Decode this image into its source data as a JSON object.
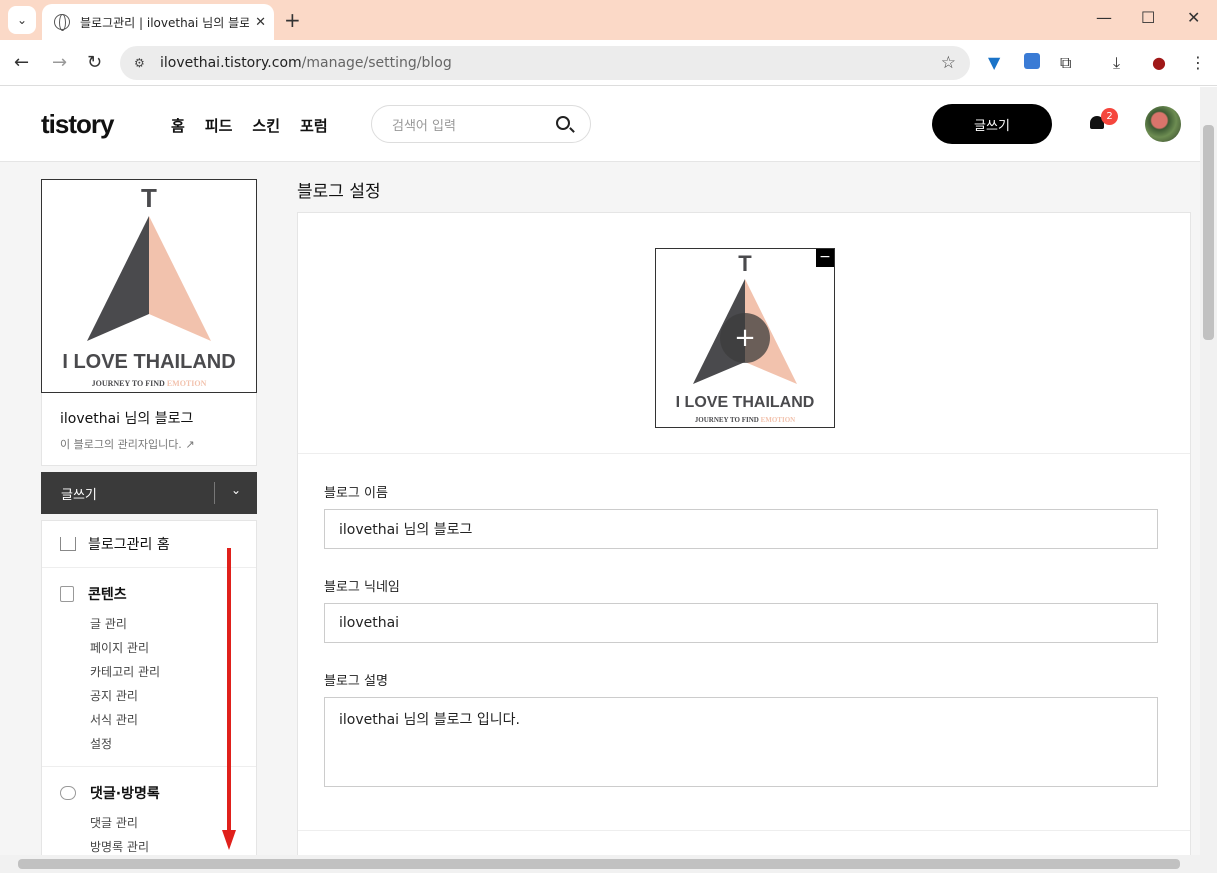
{
  "browser": {
    "tab_title": "블로그관리 | ilovethai 님의 블로그",
    "url_host": "ilovethai.tistory.com",
    "url_path": "/manage/setting/blog",
    "notification_count": "2"
  },
  "header": {
    "logo": "tistory",
    "nav": [
      "홈",
      "피드",
      "스킨",
      "포럼"
    ],
    "search_placeholder": "검색어 입력",
    "write_label": "글쓰기"
  },
  "sidebar": {
    "logo_text": "I LOVE THAILAND",
    "logo_sub1": "JOURNEY TO FIND",
    "logo_sub2": "EMOTION",
    "logo_letter": "T",
    "blog_name": "ilovethai 님의 블로그",
    "admin_note": "이 블로그의 관리자입니다.",
    "write_label": "글쓰기",
    "home_label": "블로그관리 홈",
    "groups": [
      {
        "title": "콘텐츠",
        "items": [
          "글 관리",
          "페이지 관리",
          "카테고리 관리",
          "공지 관리",
          "서식 관리",
          "설정"
        ]
      },
      {
        "title": "댓글·방명록",
        "items": [
          "댓글 관리",
          "방명록 관리"
        ]
      }
    ]
  },
  "content": {
    "title": "블로그 설정",
    "fields": [
      {
        "label": "블로그 이름",
        "value": "ilovethai 님의 블로그"
      },
      {
        "label": "블로그 닉네임",
        "value": "ilovethai"
      },
      {
        "label": "블로그 설명",
        "value": "ilovethai 님의 블로그 입니다."
      }
    ]
  },
  "colors": {
    "accent": "#000000",
    "badge": "#f5463d",
    "logo_dark": "#4a4a4d",
    "logo_peach": "#f2c2ad",
    "annotation_arrow": "#e0201b"
  }
}
